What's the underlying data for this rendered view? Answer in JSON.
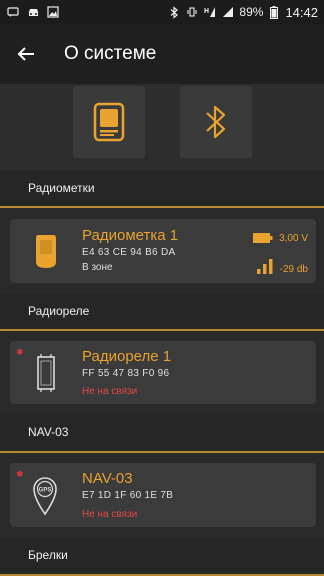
{
  "statusbar": {
    "left_icons": [
      "sms-icon",
      "car-icon",
      "image-icon"
    ],
    "battery": "89%",
    "time": "14:42"
  },
  "appbar": {
    "title": "О системе"
  },
  "sections": {
    "tags": "Радиометки",
    "relays": "Радиореле",
    "nav": "NAV-03",
    "keyfobs": "Брелки"
  },
  "cards": {
    "tag1": {
      "name": "Радиометка 1",
      "address": "E4 63 CE 94 B6 DA",
      "status": "В зоне",
      "voltage": "3,00 V",
      "signal": "-29 db"
    },
    "relay1": {
      "name": "Радиореле 1",
      "address": "FF 55 47 83 F0 96",
      "status": "Не на связи"
    },
    "nav1": {
      "name": "NAV-03",
      "address": "E7 1D 1F 60 1E 7B",
      "status": "Не на связи",
      "badge": "GPS"
    }
  },
  "colors": {
    "accent": "#e8a330",
    "error": "#e04848",
    "background": "#2a2a2a",
    "card": "#3b3b3b"
  }
}
